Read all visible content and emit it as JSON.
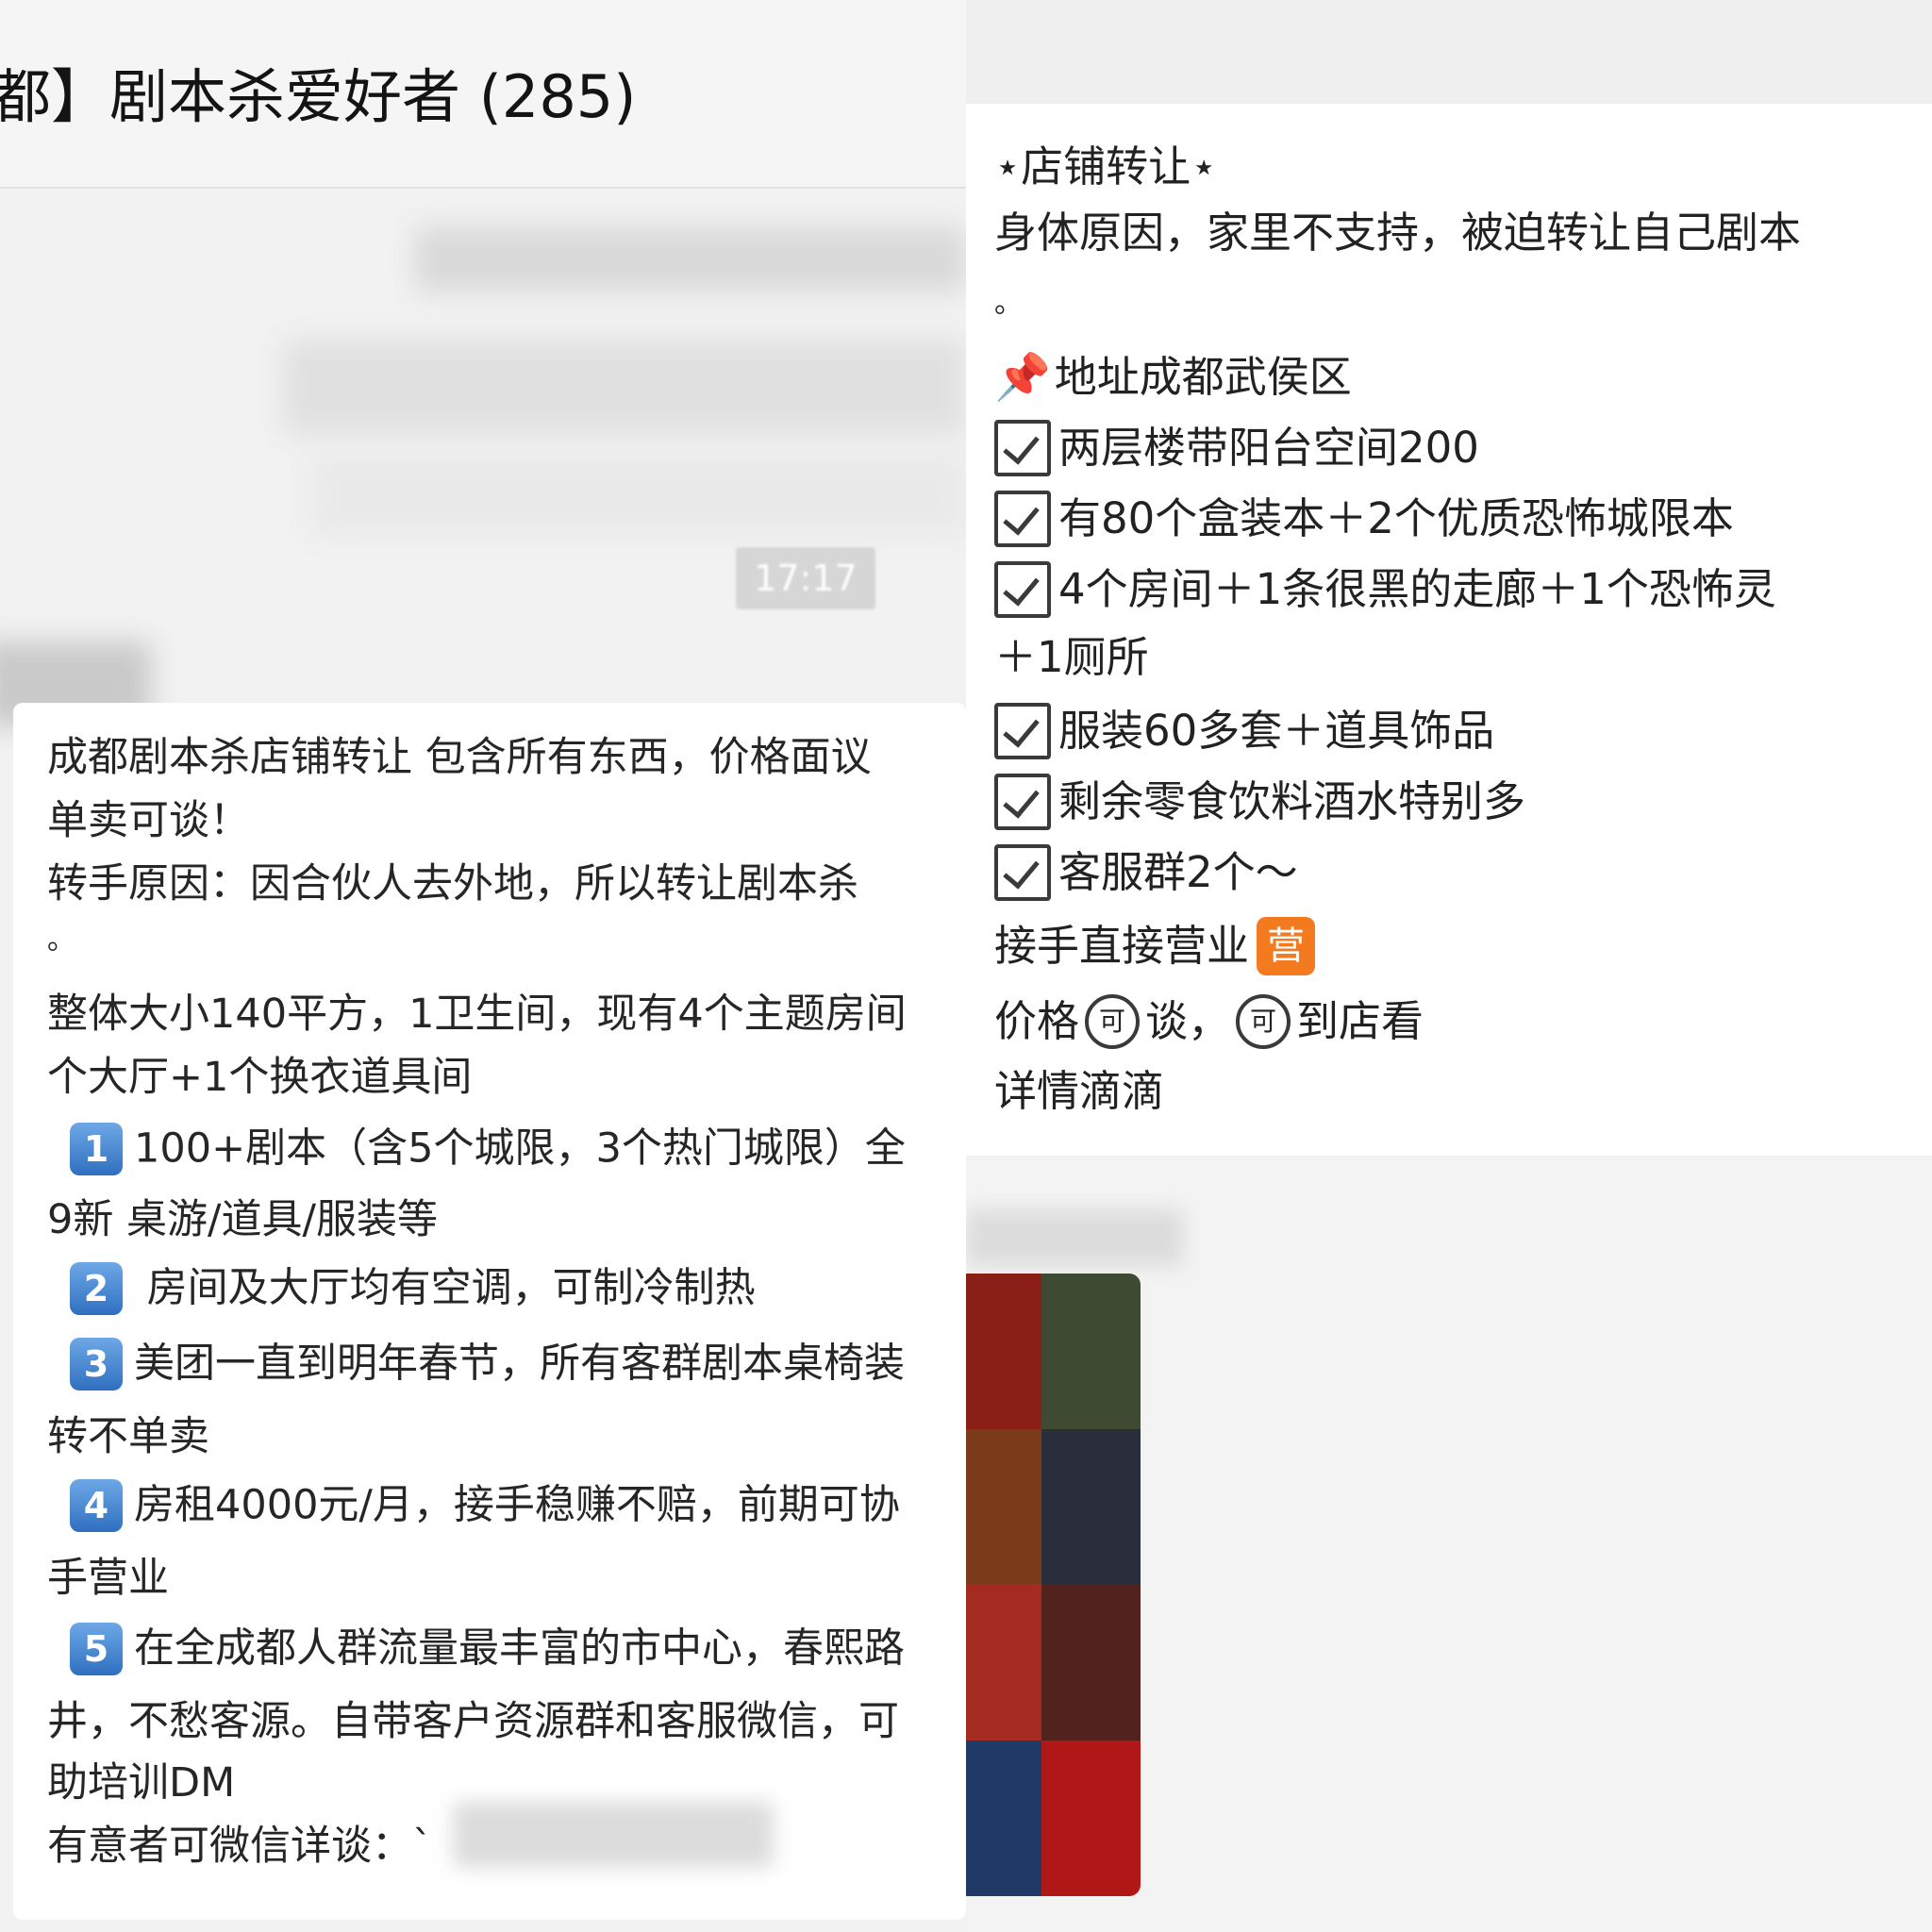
{
  "left_panel": {
    "group_title": "都】剧本杀爱好者 (285)",
    "timestamp": "17:17",
    "message_lines": [
      "成都剧本杀店铺转让 包含所有东西，价格面议",
      "单卖可谈！",
      "转手原因：因合伙人去外地，所以转让剧本杀",
      "。",
      "整体大小140平方，1卫生间，现有4个主题房间",
      "个大厅+1个换衣道具间"
    ],
    "numbered_lines": [
      {
        "badge": "1",
        "text": "100+剧本（含5个城限，3个热门城限）全"
      },
      {
        "text": "9新 桌游/道具/服装等"
      },
      {
        "badge": "2",
        "text": " 房间及大厅均有空调，可制冷制热"
      },
      {
        "badge": "3",
        "text": "美团一直到明年春节，所有客群剧本桌椅装"
      },
      {
        "text": "转不单卖"
      },
      {
        "badge": "4",
        "text": "房租4000元/月，接手稳赚不赔，前期可协"
      },
      {
        "text": "手营业"
      },
      {
        "badge": "5",
        "text": "在全成都人群流量最丰富的市中心，春熙路"
      },
      {
        "text": "井，不愁客源。自带客户资源群和客服微信，可"
      },
      {
        "text": "助培训DM"
      },
      {
        "text": "有意者可微信详谈：`"
      }
    ]
  },
  "right_panel": {
    "heading": "⋆店铺转让⋆",
    "reason": "身体原因，家里不支持，被迫转让自己剧本",
    "period": "。",
    "address": "地址成都武侯区",
    "checklist": [
      "两层楼带阳台空间200",
      "有80个盒装本＋2个优质恐怖城限本",
      "4个房间＋1条很黑的走廊＋1个恐怖灵",
      "服装60多套＋道具饰品",
      "剩余零食饮料酒水特别多",
      "客服群2个～"
    ],
    "continuation": "＋1厕所",
    "open_line": "接手直接营业",
    "ying_glyph": "营",
    "price_line": {
      "a": "价格",
      "b": "谈，",
      "c": "到店看",
      "ke_glyph": "可"
    },
    "details": "详情滴滴",
    "icons": [
      "pin-icon",
      "checkbox-icon",
      "ying-icon",
      "ke-icon"
    ],
    "colors": {
      "accent_orange": "#f47a1f",
      "badge_blue": "#3f7fcf"
    }
  }
}
